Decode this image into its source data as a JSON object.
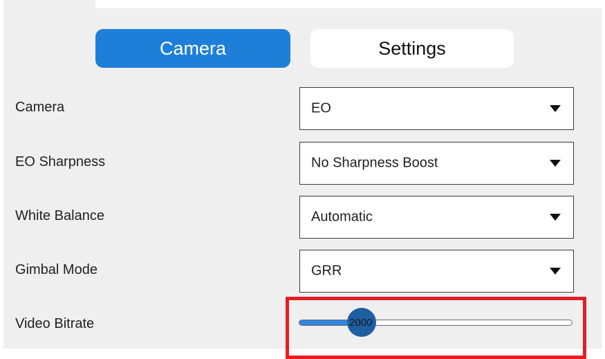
{
  "tabs": [
    {
      "label": "Camera",
      "active": true
    },
    {
      "label": "Settings",
      "active": false
    }
  ],
  "settings": [
    {
      "label": "Camera",
      "value": "EO"
    },
    {
      "label": "EO Sharpness",
      "value": "No Sharpness Boost"
    },
    {
      "label": "White Balance",
      "value": "Automatic"
    },
    {
      "label": "Gimbal Mode",
      "value": "GRR"
    }
  ],
  "bitrate": {
    "label": "Video Bitrate",
    "value": "2000",
    "fraction": 0.23
  },
  "colors": {
    "accent": "#1e7fd9",
    "highlight": "#e21e26",
    "panel": "#efefef"
  },
  "icons": [
    "dropdown-arrow-icon"
  ]
}
